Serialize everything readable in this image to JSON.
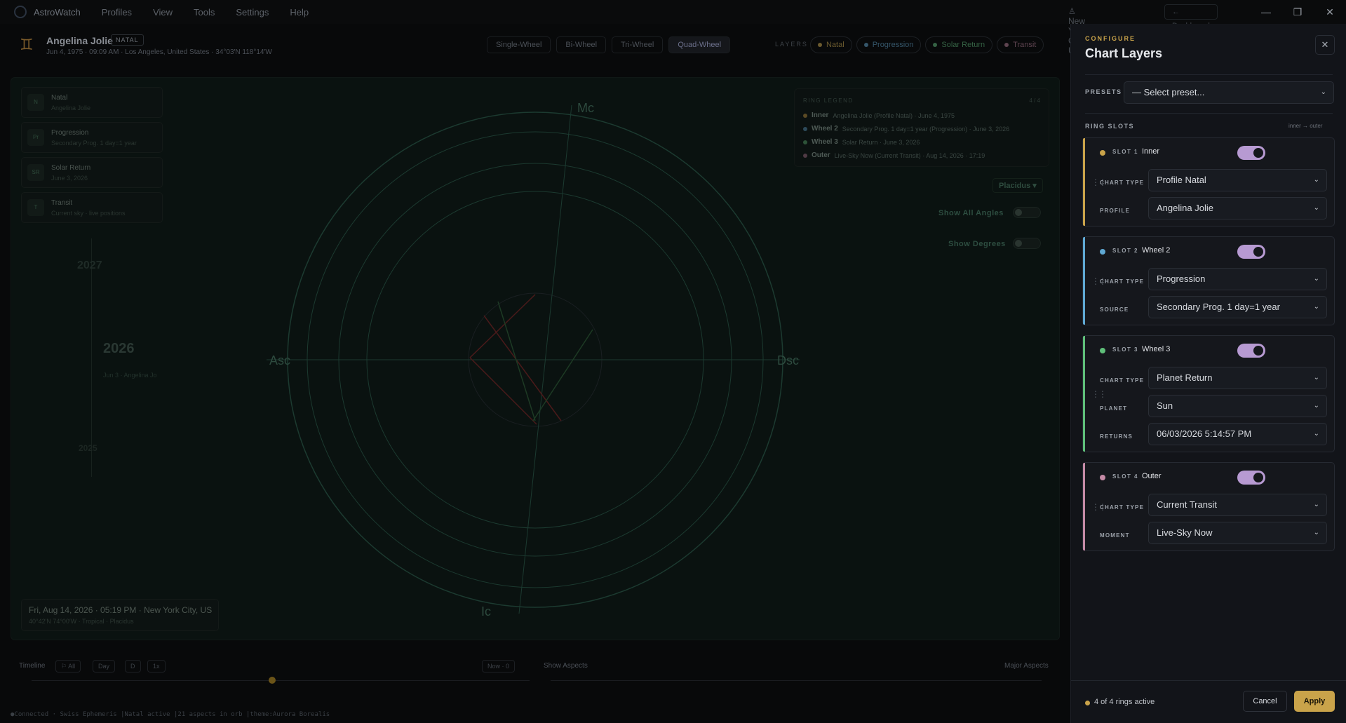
{
  "app": {
    "name": "AstroWatch",
    "menu": [
      "Profiles",
      "View",
      "Tools",
      "Settings",
      "Help"
    ],
    "location": "New York City, US",
    "dashboard_label": "Dashboard",
    "window_controls": {
      "minimize": "—",
      "maximize": "❐",
      "close": "✕"
    }
  },
  "profile": {
    "glyph": "♊",
    "name": "Angelina Jolie",
    "badge": "NATAL",
    "meta": "Jun 4, 1975 · 09:09 AM · Los Angeles, United States · 34°03′N 118°14′W"
  },
  "wheel_modes": [
    "Single-Wheel",
    "Bi-Wheel",
    "Tri-Wheel",
    "Quad-Wheel"
  ],
  "wheel_mode_active": "Quad-Wheel",
  "layers": {
    "label": "LAYERS",
    "chips": [
      {
        "label": "Natal",
        "color": "#c9a34a"
      },
      {
        "label": "Progression",
        "color": "#5fa8d3"
      },
      {
        "label": "Solar Return",
        "color": "#5fbf7a"
      },
      {
        "label": "Transit",
        "color": "#c48aa6"
      }
    ]
  },
  "side_cards": [
    {
      "abbr": "N",
      "title": "Natal",
      "sub": "Angelina Jolie"
    },
    {
      "abbr": "Pr",
      "title": "Progression",
      "sub": "Secondary Prog. 1 day=1 year"
    },
    {
      "abbr": "SR",
      "title": "Solar Return",
      "sub": "June 3, 2026"
    },
    {
      "abbr": "T",
      "title": "Transit",
      "sub": "Current sky · live positions"
    }
  ],
  "timeline_v": {
    "top_year": "2027",
    "current_year": "2026",
    "event": "Jun 3 · Angelina Jo",
    "bottom_year": "2025"
  },
  "wheel": {
    "angles": {
      "mc": "Mc",
      "asc": "Asc",
      "dsc": "Dsc",
      "ic": "Ic"
    }
  },
  "ring_legend": {
    "title": "RING LEGEND",
    "count": "4 / 4",
    "rows": [
      {
        "name": "Inner",
        "desc": "Angelina Jolie (Profile Natal) · June 4, 1975",
        "color": "#c9a34a"
      },
      {
        "name": "Wheel 2",
        "desc": "Secondary Prog. 1 day=1 year (Progression) · June 3, 2026",
        "color": "#5fa8d3"
      },
      {
        "name": "Wheel 3",
        "desc": "Solar Return · June 3, 2026",
        "color": "#5fbf7a"
      },
      {
        "name": "Outer",
        "desc": "Live-Sky Now (Current Transit) · Aug 14, 2026 · 17:19",
        "color": "#c48aa6"
      }
    ]
  },
  "house_system": "Placidus",
  "toggles": {
    "angles": "Show All Angles",
    "degrees": "Show Degrees"
  },
  "date_card": {
    "line1": "Fri, Aug 14, 2026 · 05:19 PM · New York City, US",
    "line2": "40°42′N 74°00′W · Tropical · Placidus"
  },
  "bottom": {
    "timeline_label": "Timeline",
    "chips": [
      "All",
      "Day",
      "D",
      "1x"
    ],
    "now_label": "Now · 0",
    "show_aspects": "Show Aspects",
    "major_aspects": "Major Aspects"
  },
  "status_line": "●Connected · Swiss Ephemeris  |Natal active  |21 aspects in orb  |theme:Aurora Borealis",
  "panel": {
    "kicker": "CONFIGURE",
    "title": "Chart Layers",
    "close": "✕",
    "presets_label": "PRESETS",
    "presets_value": "— Select preset...",
    "ring_slots_label": "RING SLOTS",
    "direction": "inner → outer",
    "slots": [
      {
        "slot": "SLOT 1",
        "name": "Inner",
        "color": "#c9a34a",
        "fields": [
          {
            "label": "CHART TYPE",
            "value": "Profile Natal"
          },
          {
            "label": "PROFILE",
            "value": "Angelina Jolie"
          }
        ]
      },
      {
        "slot": "SLOT 2",
        "name": "Wheel 2",
        "color": "#5fa8d3",
        "fields": [
          {
            "label": "CHART TYPE",
            "value": "Progression"
          },
          {
            "label": "SOURCE",
            "value": "Secondary Prog. 1 day=1 year"
          }
        ]
      },
      {
        "slot": "SLOT 3",
        "name": "Wheel 3",
        "color": "#5fbf7a",
        "fields": [
          {
            "label": "CHART TYPE",
            "value": "Planet Return"
          },
          {
            "label": "PLANET",
            "value": "Sun"
          },
          {
            "label": "RETURNS",
            "value": "06/03/2026 5:14:57 PM"
          }
        ]
      },
      {
        "slot": "SLOT 4",
        "name": "Outer",
        "color": "#c48aa6",
        "fields": [
          {
            "label": "CHART TYPE",
            "value": "Current Transit"
          },
          {
            "label": "MOMENT",
            "value": "Live-Sky Now"
          }
        ]
      }
    ],
    "footer_status": "4 of 4 rings active",
    "cancel": "Cancel",
    "apply": "Apply"
  }
}
